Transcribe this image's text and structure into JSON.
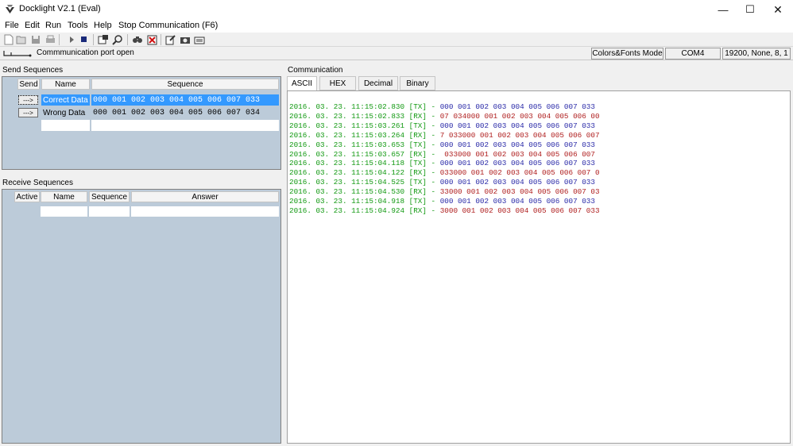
{
  "window": {
    "title": "Docklight V2.1 (Eval)",
    "min_glyph": "—",
    "max_glyph": "☐",
    "close_glyph": "✕"
  },
  "menu": {
    "items": [
      "File",
      "Edit",
      "Run",
      "Tools",
      "Help",
      "Stop Communication  (F6)"
    ]
  },
  "status": {
    "message": "Commmunication port open",
    "colors_mode": "Colors&Fonts Mode",
    "port": "COM4",
    "settings": "19200, None, 8, 1"
  },
  "send_sequences": {
    "label": "Send Sequences",
    "headers": {
      "send": "Send",
      "name": "Name",
      "sequence": "Sequence"
    },
    "button_label": "--->",
    "rows": [
      {
        "name": "Correct Data",
        "sequence": "000 001 002 003 004 005 006 007 033"
      },
      {
        "name": "Wrong Data",
        "sequence": "000 001 002 003 004 005 006 007 034"
      }
    ]
  },
  "receive_sequences": {
    "label": "Receive Sequences",
    "headers": {
      "active": "Active",
      "name": "Name",
      "sequence": "Sequence",
      "answer": "Answer"
    }
  },
  "communication": {
    "label": "Communication",
    "tabs": [
      "ASCII",
      "HEX",
      "Decimal",
      "Binary"
    ],
    "active_tab": "ASCII",
    "colors": {
      "timestamp": "#119911",
      "tx": "#2a2aa8",
      "rx": "#b02020"
    },
    "log": [
      {
        "ts": "2016. 03. 23. 11:15:02.830",
        "dir": "[TX]",
        "data": "000 001 002 003 004 005 006 007 033"
      },
      {
        "ts": "2016. 03. 23. 11:15:02.833",
        "dir": "[RX]",
        "data": "07 034000 001 002 003 004 005 006 00"
      },
      {
        "ts": "2016. 03. 23. 11:15:03.261",
        "dir": "[TX]",
        "data": "000 001 002 003 004 005 006 007 033"
      },
      {
        "ts": "2016. 03. 23. 11:15:03.264",
        "dir": "[RX]",
        "data": "7 033000 001 002 003 004 005 006 007"
      },
      {
        "ts": "2016. 03. 23. 11:15:03.653",
        "dir": "[TX]",
        "data": "000 001 002 003 004 005 006 007 033"
      },
      {
        "ts": "2016. 03. 23. 11:15:03.657",
        "dir": "[RX]",
        "data": " 033000 001 002 003 004 005 006 007"
      },
      {
        "ts": "2016. 03. 23. 11:15:04.118",
        "dir": "[TX]",
        "data": "000 001 002 003 004 005 006 007 033"
      },
      {
        "ts": "2016. 03. 23. 11:15:04.122",
        "dir": "[RX]",
        "data": "033000 001 002 003 004 005 006 007 0"
      },
      {
        "ts": "2016. 03. 23. 11:15:04.525",
        "dir": "[TX]",
        "data": "000 001 002 003 004 005 006 007 033"
      },
      {
        "ts": "2016. 03. 23. 11:15:04.530",
        "dir": "[RX]",
        "data": "33000 001 002 003 004 005 006 007 03"
      },
      {
        "ts": "2016. 03. 23. 11:15:04.918",
        "dir": "[TX]",
        "data": "000 001 002 003 004 005 006 007 033"
      },
      {
        "ts": "2016. 03. 23. 11:15:04.924",
        "dir": "[RX]",
        "data": "3000 001 002 003 004 005 006 007 033"
      }
    ]
  },
  "toolbar": {
    "icons": [
      "new-file-icon",
      "open-folder-icon",
      "save-icon",
      "print-icon",
      "run-icon",
      "stop-icon",
      "comm-settings-icon",
      "inspect-icon",
      "find-icon",
      "clear-icon",
      "edit-sequence-icon",
      "snapshot-icon",
      "keyboard-icon"
    ]
  }
}
